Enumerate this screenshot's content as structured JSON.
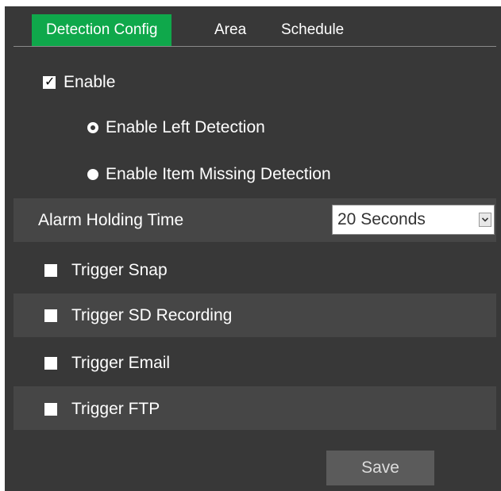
{
  "tabs": [
    {
      "label": "Detection Config",
      "active": true
    },
    {
      "label": "Area",
      "active": false
    },
    {
      "label": "Schedule",
      "active": false
    }
  ],
  "enable": {
    "label": "Enable",
    "checked": true
  },
  "detection_modes": [
    {
      "label": "Enable Left Detection",
      "selected": true
    },
    {
      "label": "Enable Item Missing Detection",
      "selected": false
    }
  ],
  "alarm_holding": {
    "label": "Alarm Holding Time",
    "value": "20 Seconds"
  },
  "triggers": [
    {
      "label": "Trigger Snap",
      "checked": false
    },
    {
      "label": "Trigger SD Recording",
      "checked": false
    },
    {
      "label": "Trigger Email",
      "checked": false
    },
    {
      "label": "Trigger FTP",
      "checked": false
    }
  ],
  "save_label": "Save",
  "colors": {
    "active_tab": "#0fa84b",
    "panel": "#383838",
    "band": "#464646"
  }
}
